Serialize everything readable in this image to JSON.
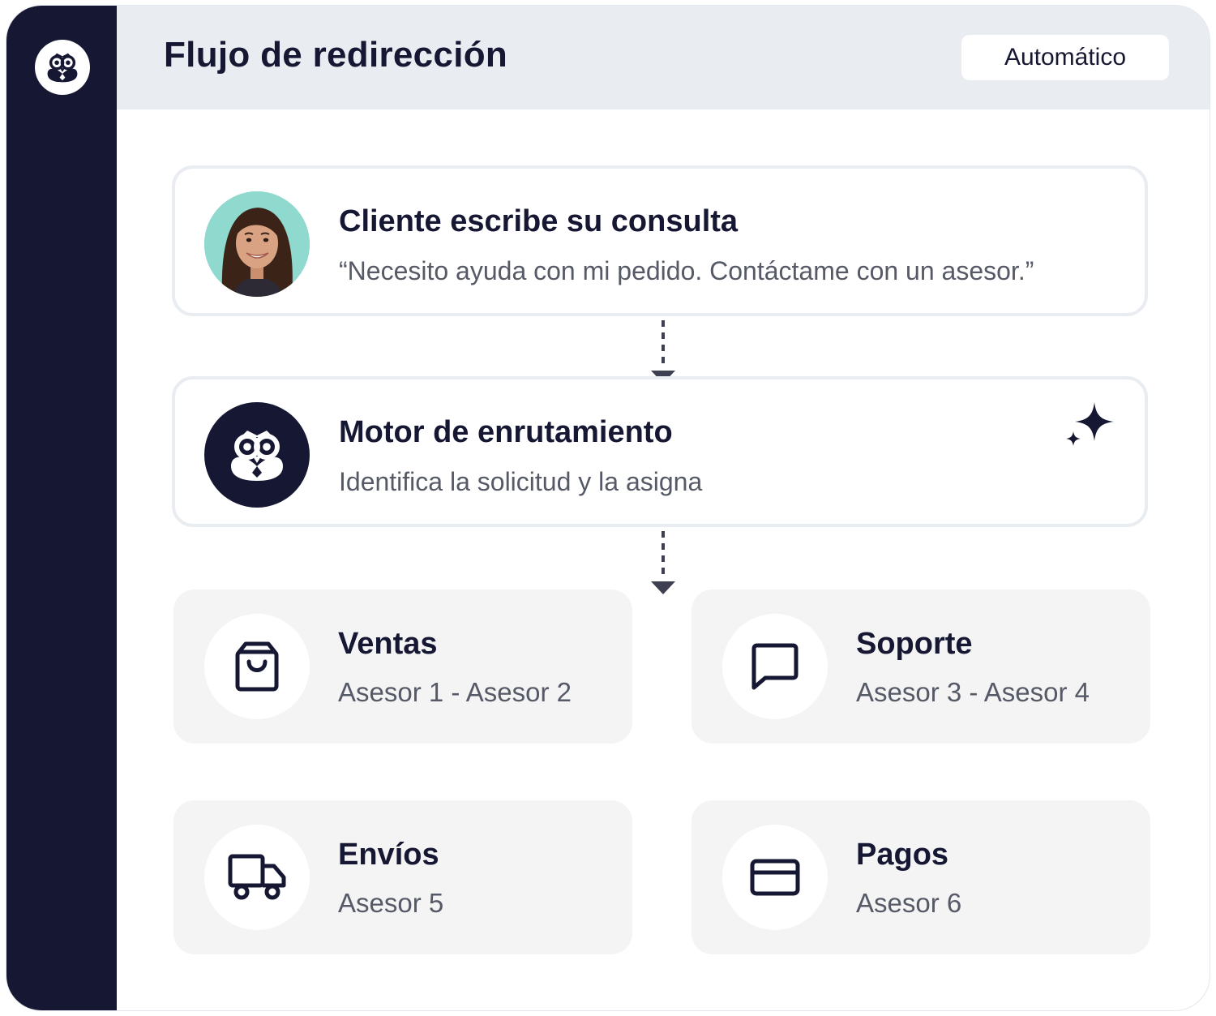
{
  "header": {
    "title": "Flujo de redirección",
    "mode_badge": "Automático"
  },
  "sidebar": {
    "logo_icon": "owl-logo-icon"
  },
  "flow": [
    {
      "title": "Cliente escribe su consulta",
      "subtitle": "“Necesito ayuda con mi pedido. Contáctame con un asesor.”",
      "icon": "customer-avatar"
    },
    {
      "title": "Motor de enrutamiento",
      "subtitle": "Identifica la solicitud y la asigna",
      "icon": "owl-logo-icon",
      "badge_icon": "sparkle-icon"
    }
  ],
  "teams": [
    {
      "title": "Ventas",
      "agents": "Asesor 1 - Asesor 2",
      "icon": "shopping-bag-icon"
    },
    {
      "title": "Soporte",
      "agents": "Asesor 3 - Asesor 4",
      "icon": "chat-bubble-icon"
    },
    {
      "title": "Envíos",
      "agents": "Asesor 5",
      "icon": "truck-icon"
    },
    {
      "title": "Pagos",
      "agents": "Asesor 6",
      "icon": "credit-card-icon"
    }
  ],
  "colors": {
    "sidebar": "#161833",
    "header_bg": "#e9ecf1",
    "card_border": "#e9ecf1",
    "team_bg": "#f4f4f5",
    "text_primary": "#161833",
    "text_secondary": "#555a66"
  }
}
